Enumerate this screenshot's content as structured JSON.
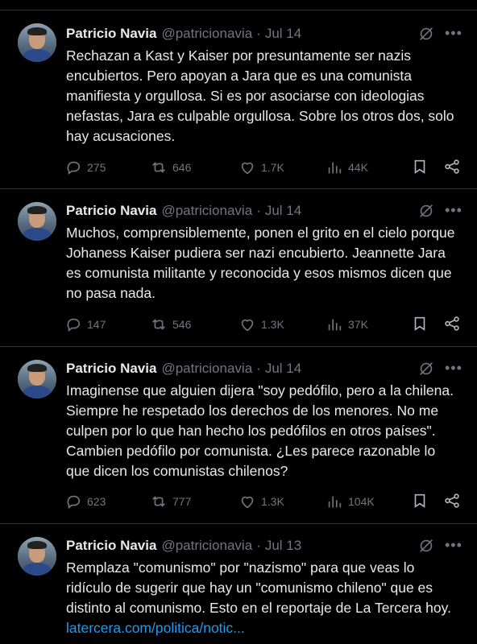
{
  "tweets": [
    {
      "author": "Patricio Navia",
      "handle": "@patricionavia",
      "separator": "·",
      "date": "Jul 14",
      "text": "Rechazan a Kast y Kaiser por presuntamente ser nazis encubiertos. Pero apoyan a Jara que es una comunista manifiesta y orgullosa. Si es por asociarse con ideologias nefastas, Jara es culpable orgullosa. Sobre los otros dos, solo hay acusaciones.",
      "link": "",
      "replies": "275",
      "reposts": "646",
      "likes": "1.7K",
      "views": "44K"
    },
    {
      "author": "Patricio Navia",
      "handle": "@patricionavia",
      "separator": "·",
      "date": "Jul 14",
      "text": "Muchos, comprensiblemente, ponen el grito en el cielo porque Johaness Kaiser pudiera ser nazi encubierto. Jeannette Jara es comunista militante y reconocida y esos mismos dicen que no pasa nada.",
      "link": "",
      "replies": "147",
      "reposts": "546",
      "likes": "1.3K",
      "views": "37K"
    },
    {
      "author": "Patricio Navia",
      "handle": "@patricionavia",
      "separator": "·",
      "date": "Jul 14",
      "text": "Imaginense que alguien dijera \"soy pedófilo, pero a la chilena. Siempre he respetado los derechos de los menores. No me culpen por lo que han hecho los pedófilos en otros países\". Cambien pedófilo por comunista. ¿Les parece razonable lo que dicen los comunistas chilenos?",
      "link": "",
      "replies": "623",
      "reposts": "777",
      "likes": "1.3K",
      "views": "104K"
    },
    {
      "author": "Patricio Navia",
      "handle": "@patricionavia",
      "separator": "·",
      "date": "Jul 13",
      "text": "Remplaza \"comunismo\" por \"nazismo\" para que veas lo ridículo de sugerir que hay un \"comunismo chileno\" que es distinto al comunismo. Esto en el reportaje de La Tercera hoy. ",
      "link": "latercera.com/politica/notic...",
      "replies": "",
      "reposts": "",
      "likes": "",
      "views": ""
    }
  ],
  "icons": {
    "reply": "reply-icon",
    "repost": "repost-icon",
    "like": "like-icon",
    "views": "views-icon",
    "bookmark": "bookmark-icon",
    "share": "share-icon",
    "grok": "grok-icon",
    "more": "more-icon"
  },
  "colors": {
    "background": "#000000",
    "text": "#e7e9ea",
    "muted": "#71767b",
    "link": "#1d9bf0",
    "divider": "#2f3336"
  }
}
